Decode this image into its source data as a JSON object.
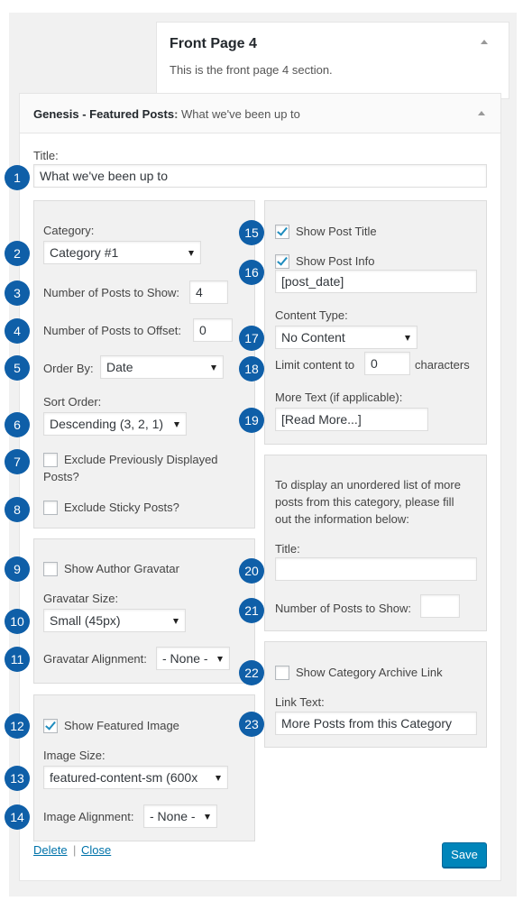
{
  "section": {
    "title": "Front Page 4",
    "description": "This is the front page 4 section."
  },
  "widget": {
    "name": "Genesis - Featured Posts",
    "separator": ":",
    "instance_title": "What we've been up to"
  },
  "fields": {
    "title_label": "Title:",
    "title_value": "What we've been up to",
    "category_label": "Category:",
    "category_value": "Category #1",
    "num_posts_label": "Number of Posts to Show:",
    "num_posts_value": "4",
    "offset_label": "Number of Posts to Offset:",
    "offset_value": "0",
    "order_by_label": "Order By:",
    "order_by_value": "Date",
    "sort_order_label": "Sort Order:",
    "sort_order_value": "Descending (3, 2, 1)",
    "exclude_prev_line1": "Exclude Previously Displayed",
    "exclude_prev_line2": "Posts?",
    "exclude_sticky_label": "Exclude Sticky Posts?",
    "show_gravatar_label": "Show Author Gravatar",
    "gravatar_size_label": "Gravatar Size:",
    "gravatar_size_value": "Small (45px)",
    "gravatar_align_label": "Gravatar Alignment:",
    "gravatar_align_value": "- None -",
    "show_featured_label": "Show Featured Image",
    "image_size_label": "Image Size:",
    "image_size_value": "featured-content-sm (600x",
    "image_align_label": "Image Alignment:",
    "image_align_value": "- None -",
    "show_post_title_label": "Show Post Title",
    "show_post_info_label": "Show Post Info",
    "post_info_value": "[post_date]",
    "content_type_label": "Content Type:",
    "content_type_value": "No Content",
    "limit_label_before": "Limit content to",
    "limit_value": "0",
    "limit_label_after": "characters",
    "more_text_label": "More Text (if applicable):",
    "more_text_value": "[Read More...]",
    "extra_desc_line1": "To display an unordered list of more",
    "extra_desc_line2": "posts from this category, please fill",
    "extra_desc_line3": "out the information below:",
    "extra_title_label": "Title:",
    "extra_title_value": "",
    "extra_num_label": "Number of Posts to Show:",
    "extra_num_value": "",
    "show_archive_label": "Show Category Archive Link",
    "link_text_label": "Link Text:",
    "link_text_value": "More Posts from this Category"
  },
  "checkboxes": {
    "exclude_prev": false,
    "exclude_sticky": false,
    "show_gravatar": false,
    "show_featured": true,
    "show_post_title": true,
    "show_post_info": true,
    "show_archive": false
  },
  "footer": {
    "delete_label": "Delete",
    "divider": "|",
    "close_label": "Close",
    "save_label": "Save"
  },
  "badges": [
    "1",
    "2",
    "3",
    "4",
    "5",
    "6",
    "7",
    "8",
    "9",
    "10",
    "11",
    "12",
    "13",
    "14",
    "15",
    "16",
    "17",
    "18",
    "19",
    "20",
    "21",
    "22",
    "23"
  ],
  "colors": {
    "badge": "#0f5fa8",
    "accent": "#0085ba",
    "link": "#0073aa",
    "check": "#1e8cbe"
  }
}
